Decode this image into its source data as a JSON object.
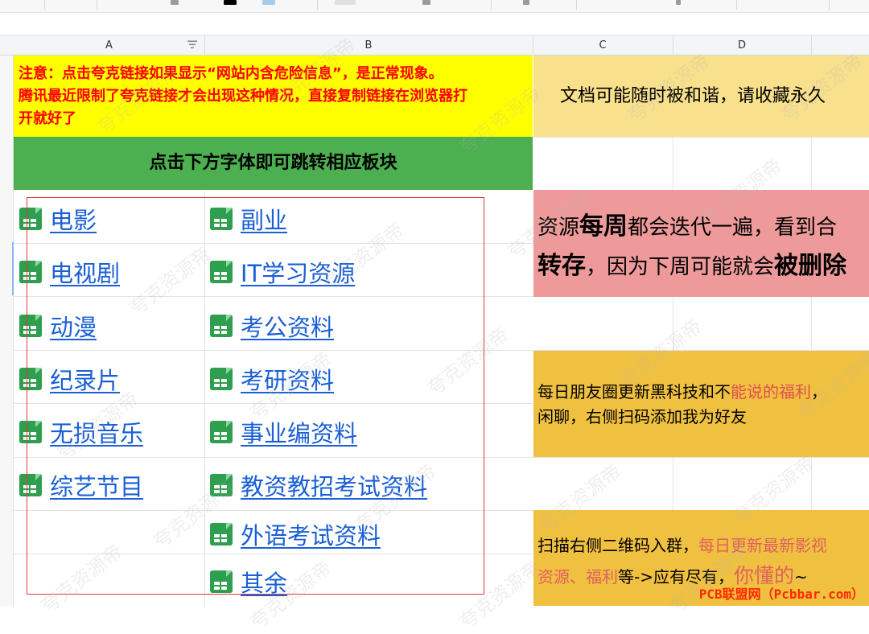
{
  "columns": {
    "a": "A",
    "b": "B",
    "c": "C",
    "d": "D"
  },
  "notice": {
    "line1": "注意：点击夸克链接如果显示“网站内含危险信息”，是正常现象。",
    "line2": "腾讯最近限制了夸克链接才会出现这种情况，直接复制链接在浏览器打",
    "line3": "开就好了"
  },
  "nav_header": "点击下方字体即可跳转相应板块",
  "doc_warning": "文档可能随时被和谐，请收藏永久",
  "weekly": {
    "part1": "资源",
    "bold1": "每周",
    "part2": "都会迭代一遍，看到合",
    "bold2": "转存",
    "part3": "，因为下周可能就会",
    "bold3": "被删除"
  },
  "moments": {
    "part1": "每日朋友圈更新黑科技和不",
    "red1": "能说的福利",
    "part2": "，",
    "line2": "闲聊，右侧扫码添加我为好友"
  },
  "qr": {
    "part1": "扫描右侧二维码入群，",
    "red1": "每日更新最新影视",
    "red2": "资源、福利",
    "part2": "等->应有尽有，",
    "big": "你懂的",
    "tail": "~"
  },
  "links_col_a": [
    "电影",
    "电视剧",
    "动漫",
    "纪录片",
    "无损音乐",
    "综艺节目"
  ],
  "links_col_b": [
    "副业",
    "IT学习资源",
    "考公资料",
    "考研资料",
    "事业编资料",
    "教资教招考试资料",
    "外语考试资料",
    "其余"
  ],
  "watermark_text": "夸克资源帝",
  "credit": "PCB联盟网（Pcbbar.com）",
  "colors": {
    "notice_bg": "#ffff00",
    "nav_bg": "#4caf50",
    "link": "#1a5fd6",
    "weekly_bg": "#ee9a9a",
    "promo_bg": "#f0c040",
    "doc_bg": "#f8e08c",
    "sheet_icon": "#2e9e4f"
  },
  "icons": {
    "sheet": "spreadsheet-icon",
    "filter": "filter-icon"
  }
}
